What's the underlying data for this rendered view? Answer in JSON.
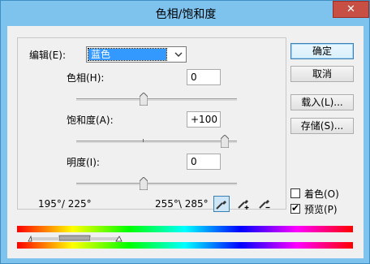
{
  "window": {
    "title": "色相/饱和度",
    "close_label": "✕"
  },
  "edit": {
    "label": "编辑(E):",
    "selected": "蓝色"
  },
  "hue": {
    "label": "色相(H):",
    "value": "0"
  },
  "saturation": {
    "label": "饱和度(A):",
    "value": "+100"
  },
  "lightness": {
    "label": "明度(I):",
    "value": "0"
  },
  "buttons": {
    "ok": "确定",
    "cancel": "取消",
    "load": "载入(L)...",
    "save": "存储(S)..."
  },
  "checkboxes": {
    "colorize": {
      "label": "着色(O)",
      "checked": false
    },
    "preview": {
      "label": "预览(P)",
      "checked": true
    }
  },
  "range": {
    "left_text": "195°/ 225°",
    "right_text": "255°\\ 285°"
  },
  "icons": [
    "eyedropper-icon",
    "eyedropper-plus-icon",
    "eyedropper-minus-icon"
  ],
  "colors": {
    "title_bar": "#7ec2ee",
    "selection": "#3399ff",
    "close": "#c74f44"
  }
}
